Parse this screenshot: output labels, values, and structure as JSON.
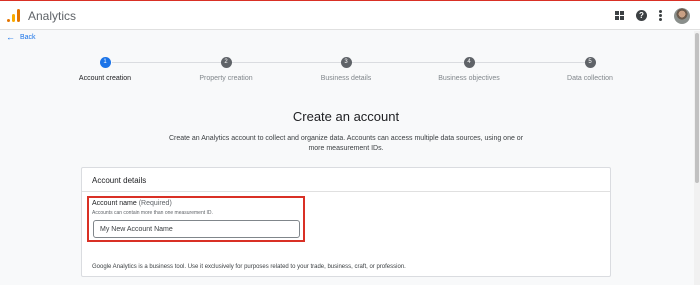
{
  "app": {
    "title": "Analytics"
  },
  "header": {
    "apps_icon": "apps-grid-icon",
    "help_icon": "help-icon",
    "help_glyph": "?",
    "more_icon": "more-vert-icon",
    "avatar_icon": "user-avatar"
  },
  "nav": {
    "back_label": "Back",
    "back_glyph": "←"
  },
  "stepper": {
    "steps": [
      {
        "number": "1",
        "label": "Account creation",
        "active": true
      },
      {
        "number": "2",
        "label": "Property creation",
        "active": false
      },
      {
        "number": "3",
        "label": "Business details",
        "active": false
      },
      {
        "number": "4",
        "label": "Business objectives",
        "active": false
      },
      {
        "number": "5",
        "label": "Data collection",
        "active": false
      }
    ]
  },
  "main": {
    "heading": "Create an account",
    "description": "Create an Analytics account to collect and organize data. Accounts can access multiple data sources, using one or more measurement IDs."
  },
  "account_details": {
    "title": "Account details",
    "field_label": "Account name",
    "field_required": "(Required)",
    "field_hint": "Accounts can contain more than one measurement ID.",
    "field_placeholder": "My New Account Name",
    "field_value": "",
    "footnote": "Google Analytics is a business tool. Use it exclusively for purposes related to your trade, business, craft, or profession."
  },
  "colors": {
    "accent": "#1a73e8",
    "highlight": "#d93025",
    "step_inactive": "#5f6368"
  }
}
